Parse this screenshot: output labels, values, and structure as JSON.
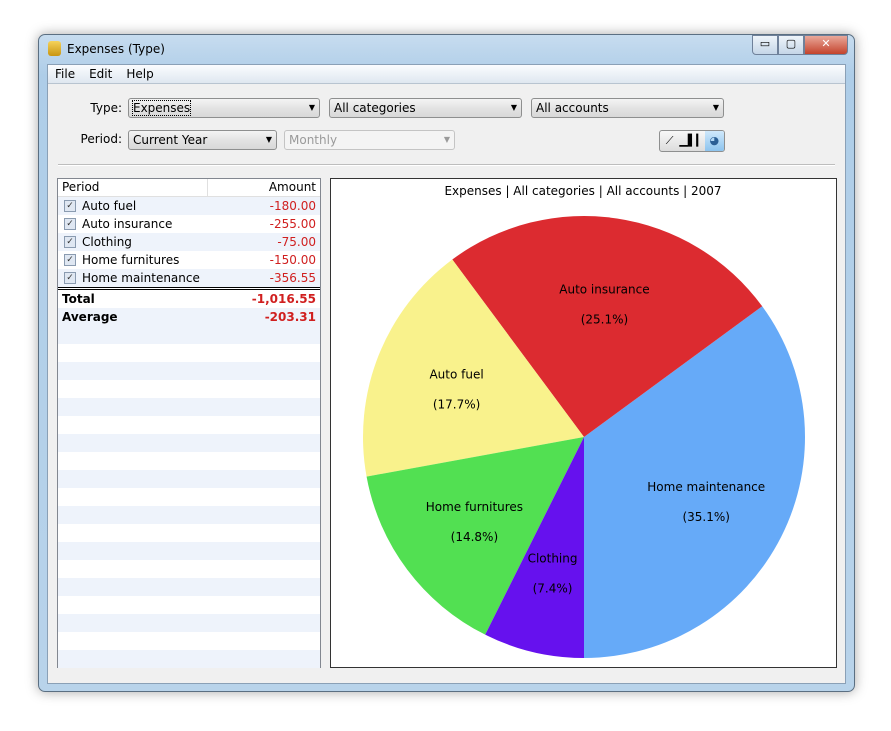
{
  "window": {
    "title": "Expenses (Type)",
    "min": "▭",
    "max": "▢",
    "close": "✕"
  },
  "menu": [
    "File",
    "Edit",
    "Help"
  ],
  "filters": {
    "type_label": "Type:",
    "type_value": "Expenses",
    "category_value": "All categories",
    "account_value": "All accounts",
    "period_label": "Period:",
    "period_value": "Current Year",
    "interval_value": "Monthly"
  },
  "view_buttons": {
    "line": "line-chart-icon",
    "bar": "bar-chart-icon",
    "pie": "pie-chart-icon",
    "selected": "pie"
  },
  "table": {
    "headers": [
      "Period",
      "Amount"
    ],
    "rows": [
      {
        "label": "Auto fuel",
        "amount": "-180.00"
      },
      {
        "label": "Auto insurance",
        "amount": "-255.00"
      },
      {
        "label": "Clothing",
        "amount": "-75.00"
      },
      {
        "label": "Home furnitures",
        "amount": "-150.00"
      },
      {
        "label": "Home maintenance",
        "amount": "-356.55"
      }
    ],
    "total_label": "Total",
    "total": "-1,016.55",
    "average_label": "Average",
    "average": "-203.31"
  },
  "chart_data": {
    "type": "pie",
    "title": "Expenses | All categories | All accounts | 2007",
    "slices": [
      {
        "label": "Home maintenance",
        "value": 356.55,
        "pct": "(35.1%)",
        "color": "#66aaf8"
      },
      {
        "label": "Auto insurance",
        "value": 255.0,
        "pct": "(25.1%)",
        "color": "#dc2b30"
      },
      {
        "label": "Auto fuel",
        "value": 180.0,
        "pct": "(17.7%)",
        "color": "#f9f28c"
      },
      {
        "label": "Home furnitures",
        "value": 150.0,
        "pct": "(14.8%)",
        "color": "#52e052"
      },
      {
        "label": "Clothing",
        "value": 75.0,
        "pct": "(7.4%)",
        "color": "#6611ee"
      }
    ]
  }
}
